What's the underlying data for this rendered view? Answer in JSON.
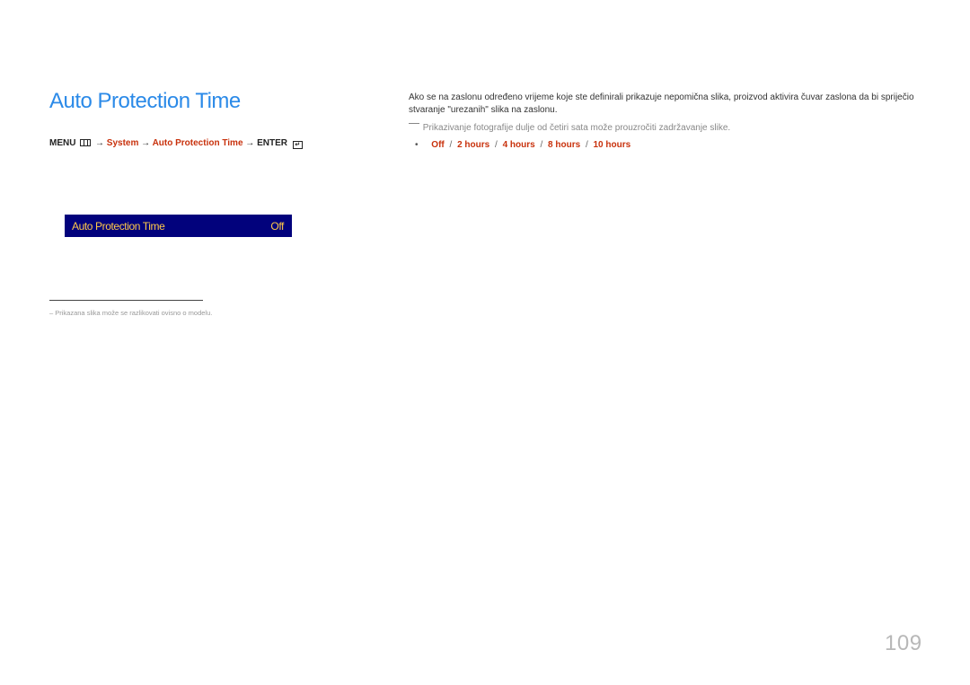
{
  "header": {
    "title": "Auto Protection Time"
  },
  "menu_path": {
    "menu_label": "MENU",
    "arrow": "→",
    "system": "System",
    "item": "Auto Protection Time",
    "enter_label": "ENTER",
    "enter_glyph": "↵"
  },
  "osd": {
    "label": "Auto Protection Time",
    "value": "Off",
    "colors": {
      "background": "#02027c",
      "text": "#ffc94a"
    }
  },
  "footnote": {
    "text": "–  Prikazana slika može se razlikovati ovisno o modelu."
  },
  "description": {
    "text": "Ako se na zaslonu određeno vrijeme koje ste definirali prikazuje nepomična slika, proizvod aktivira čuvar zaslona da bi spriječio stvaranje \"urezanih\" slika na zaslonu."
  },
  "note": {
    "text": "Prikazivanje fotografije dulje od četiri sata može prouzročiti zadržavanje slike."
  },
  "options": {
    "bullet": "•",
    "separator": "/",
    "items": [
      "Off",
      "2 hours",
      "4 hours",
      "8 hours",
      "10 hours"
    ]
  },
  "page": {
    "number": "109"
  },
  "colors": {
    "title": "#2b8ae8",
    "accent_red": "#c8310c"
  }
}
